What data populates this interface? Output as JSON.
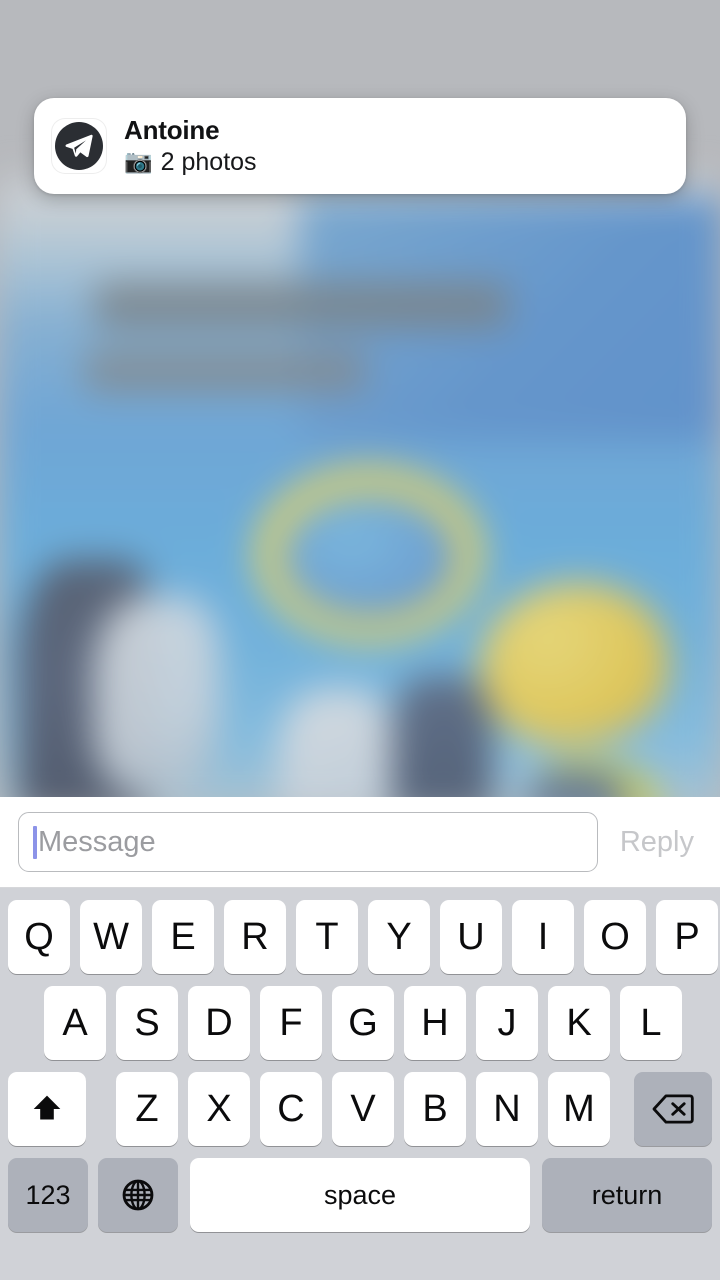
{
  "notification": {
    "app_icon": "telegram-paper-plane-icon",
    "title": "Antoine",
    "body_emoji": "📷",
    "body_text": "2 photos"
  },
  "reply_bar": {
    "placeholder": "Message",
    "value": "",
    "reply_label": "Reply"
  },
  "keyboard": {
    "row1": [
      "Q",
      "W",
      "E",
      "R",
      "T",
      "Y",
      "U",
      "I",
      "O",
      "P"
    ],
    "row2": [
      "A",
      "S",
      "D",
      "F",
      "G",
      "H",
      "J",
      "K",
      "L"
    ],
    "row3": [
      "Z",
      "X",
      "C",
      "V",
      "B",
      "N",
      "M"
    ],
    "shift_icon": "shift-arrow-icon",
    "backspace_icon": "backspace-delete-icon",
    "numbers_label": "123",
    "globe_icon": "globe-language-icon",
    "space_label": "space",
    "return_label": "return"
  },
  "colors": {
    "keyboard_background": "#d0d2d7",
    "key_white": "#ffffff",
    "key_grey": "#adb1ba",
    "banner_white": "#ffffff",
    "caret_blue": "#8c93e8",
    "reply_disabled": "#c6c7ca",
    "screen_dim": "#b9babe"
  }
}
